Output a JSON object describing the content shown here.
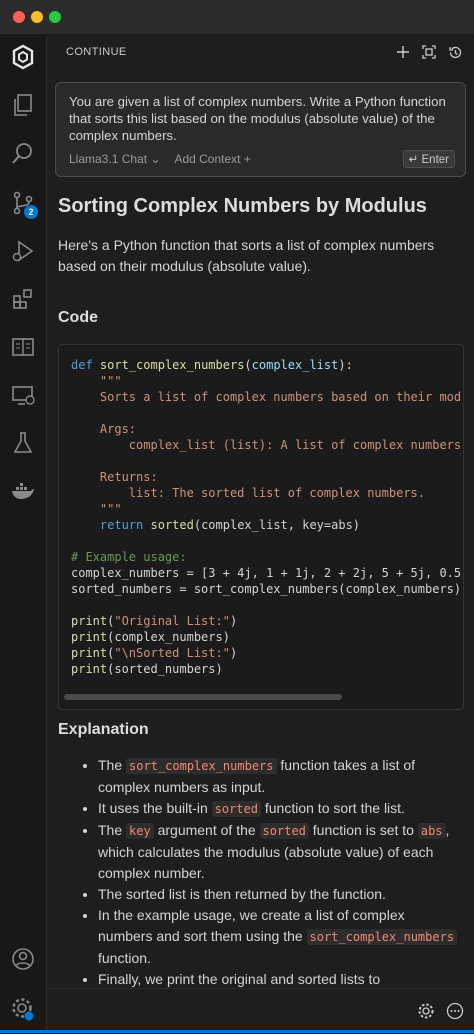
{
  "panel": {
    "title": "CONTINUE"
  },
  "activity": {
    "source_control_badge": "2"
  },
  "input": {
    "prompt": "You are given a list of complex numbers. Write a Python function that sorts this list based on the modulus (absolute value) of the complex numbers.",
    "model": "Llama3.1 Chat",
    "add_context": "Add Context",
    "enter": "Enter"
  },
  "response": {
    "title": "Sorting Complex Numbers by Modulus",
    "intro": "Here's a Python function that sorts a list of complex numbers based on their modulus (absolute value).",
    "code_heading": "Code",
    "explanation_heading": "Explanation",
    "bullets": [
      {
        "pre": "The ",
        "code": "sort_complex_numbers",
        "post": " function takes a list of complex numbers as input."
      },
      {
        "pre": "It uses the built-in ",
        "code": "sorted",
        "post": " function to sort the list."
      },
      {
        "pre": "The ",
        "code": "key",
        "mid": " argument of the ",
        "code2": "sorted",
        "mid2": " function is set to ",
        "code3": "abs",
        "post": ", which calculates the modulus (absolute value) of each complex number."
      },
      {
        "text": "The sorted list is then returned by the function."
      },
      {
        "pre": "In the example usage, we create a list of complex numbers and sort them using the ",
        "code": "sort_complex_numbers",
        "post": " function."
      },
      {
        "text": "Finally, we print the original and sorted lists to"
      }
    ]
  },
  "code_lines": [
    "def sort_complex_numbers(complex_list):",
    "    \"\"\"",
    "    Sorts a list of complex numbers based on their mod",
    "",
    "    Args:",
    "        complex_list (list): A list of complex numbers",
    "",
    "    Returns:",
    "        list: The sorted list of complex numbers.",
    "    \"\"\"",
    "    return sorted(complex_list, key=abs)",
    "",
    "# Example usage:",
    "complex_numbers = [3 + 4j, 1 + 1j, 2 + 2j, 5 + 5j, 0.5",
    "sorted_numbers = sort_complex_numbers(complex_numbers)",
    "",
    "print(\"Original List:\")",
    "print(complex_numbers)",
    "print(\"\\nSorted List:\")",
    "print(sorted_numbers)"
  ]
}
